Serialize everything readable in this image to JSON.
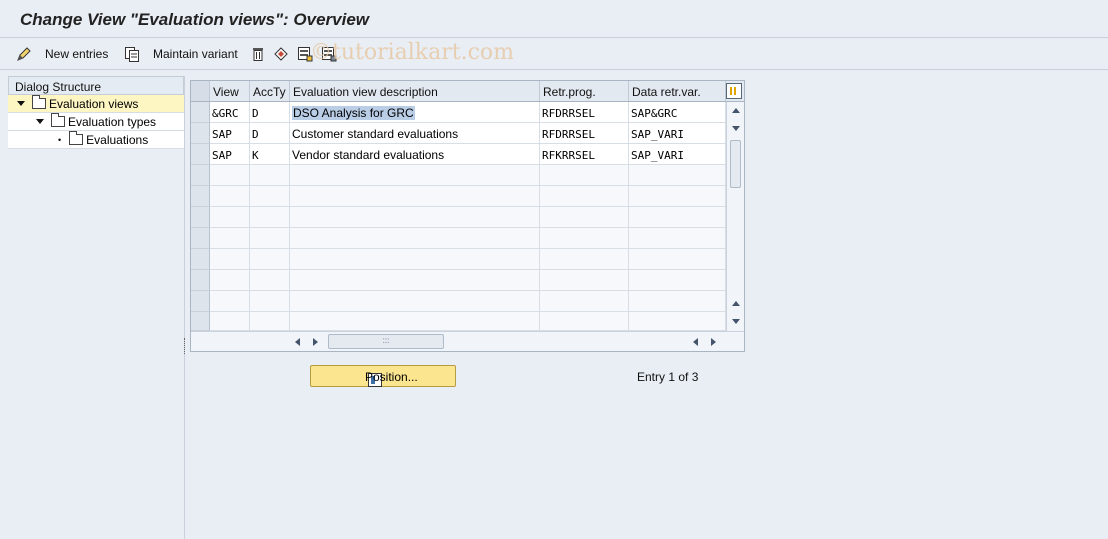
{
  "window": {
    "title": "Change View \"Evaluation views\": Overview"
  },
  "toolbar": {
    "new_entries": "New entries",
    "maintain_variant": "Maintain variant",
    "watermark": "©tutorialkart.com"
  },
  "dialog": {
    "header": "Dialog Structure",
    "items": [
      {
        "label": "Evaluation views",
        "level": 0,
        "expanded": true,
        "selected": true
      },
      {
        "label": "Evaluation types",
        "level": 1,
        "expanded": true,
        "selected": false
      },
      {
        "label": "Evaluations",
        "level": 2,
        "expanded": false,
        "selected": false
      }
    ]
  },
  "table": {
    "columns": [
      "View",
      "AccTy",
      "Evaluation view description",
      "Retr.prog.",
      "Data retr.var."
    ],
    "rows": [
      {
        "view": "&GRC",
        "accty": "D",
        "desc": "DSO Analysis for GRC",
        "prog": "RFDRRSEL",
        "var": "SAP&GRC"
      },
      {
        "view": "SAP",
        "accty": "D",
        "desc": "Customer standard evaluations",
        "prog": "RFDRRSEL",
        "var": "SAP_VARI"
      },
      {
        "view": "SAP",
        "accty": "K",
        "desc": "Vendor standard evaluations",
        "prog": "RFKRRSEL",
        "var": "SAP_VARI"
      }
    ]
  },
  "footer": {
    "position_label": "Position...",
    "entry_text": "Entry 1 of 3"
  }
}
